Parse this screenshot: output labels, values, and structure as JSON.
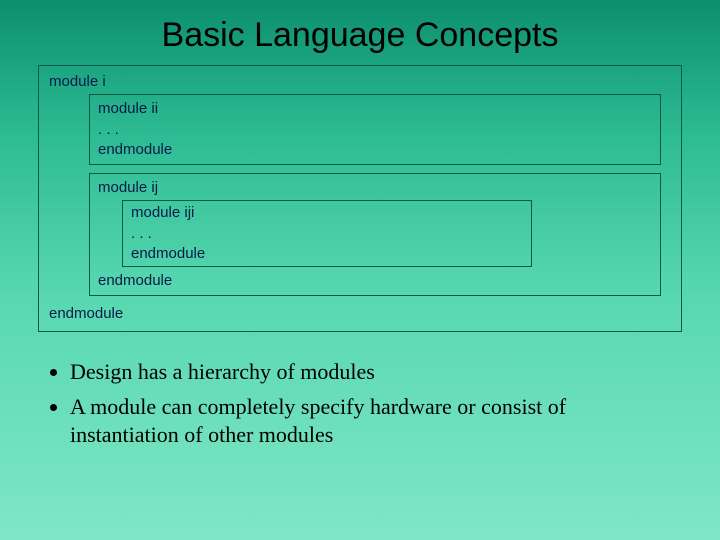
{
  "title": "Basic Language Concepts",
  "outer": {
    "start": "module i",
    "end": "endmodule"
  },
  "block1": {
    "start": "module ii",
    "body": ". . .",
    "end": "endmodule"
  },
  "block2": {
    "start": "module ij",
    "inner": {
      "start": "module iji",
      "body": ". . .",
      "end": "endmodule"
    },
    "end": "endmodule"
  },
  "bullets": {
    "item1": "Design has a hierarchy of modules",
    "item2": "A module can completely specify hardware or consist of instantiation of other modules"
  }
}
